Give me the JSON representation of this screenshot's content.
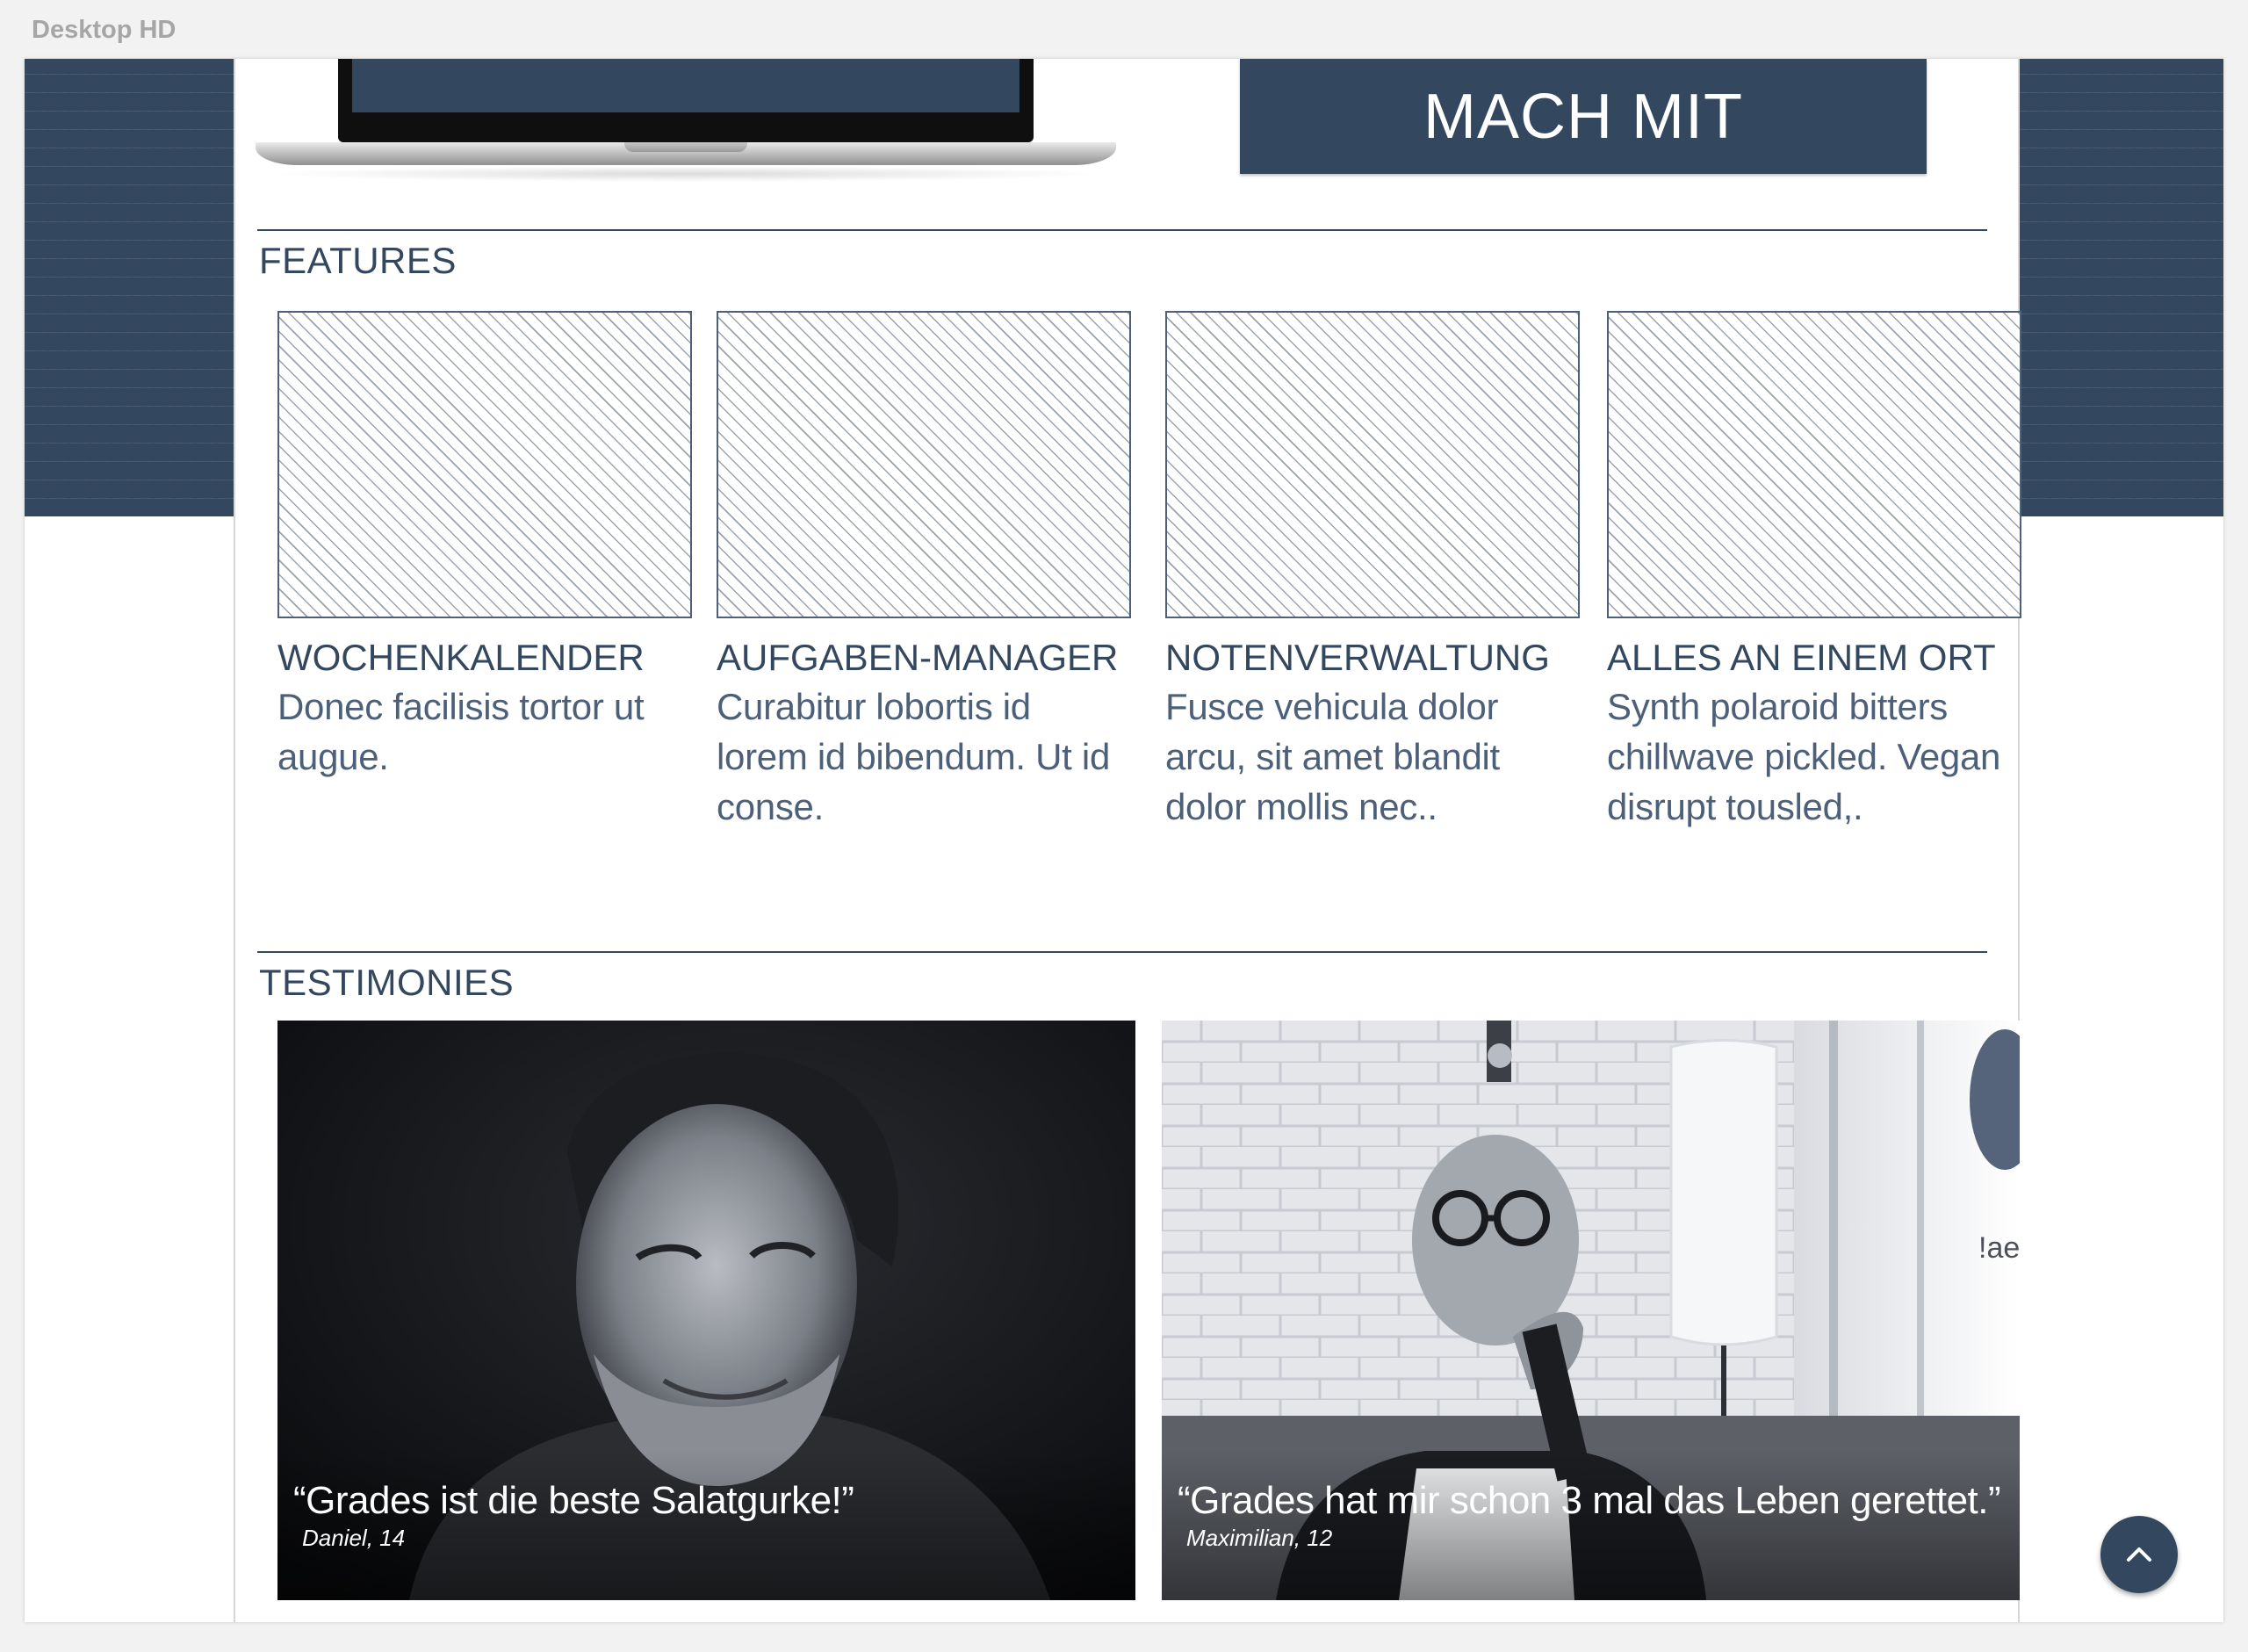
{
  "artboard": {
    "label": "Desktop HD"
  },
  "hero": {
    "cta_label": "MACH MIT"
  },
  "features": {
    "heading": "FEATURES",
    "items": [
      {
        "title": "WOCHENKALENDER",
        "text": "Donec facilisis tortor ut augue."
      },
      {
        "title": "AUFGABEN-MANAGER",
        "text": "Curabitur lobortis id lorem id bibendum. Ut id conse."
      },
      {
        "title": "NOTENVERWALTUNG",
        "text": "Fusce vehicula dolor arcu, sit amet blandit dolor mollis nec.."
      },
      {
        "title": "ALLES AN EINEM ORT",
        "text": "Synth polaroid bitters chillwave pickled. Vegan disrupt tousled,."
      }
    ]
  },
  "testimonies": {
    "heading": "TESTIMONIES",
    "items": [
      {
        "quote": "“Grades ist die beste Salatgurke!”",
        "author": "Daniel, 14"
      },
      {
        "quote": "“Grades hat mir schon 3 mal das Leben gerettet.”",
        "author": "Maximilian, 12"
      }
    ]
  },
  "scroll_top": {
    "icon": "chevron-up-icon"
  },
  "colors": {
    "brand": "#33475f",
    "canvas": "#ffffff",
    "desk": "#f2f2f2"
  }
}
